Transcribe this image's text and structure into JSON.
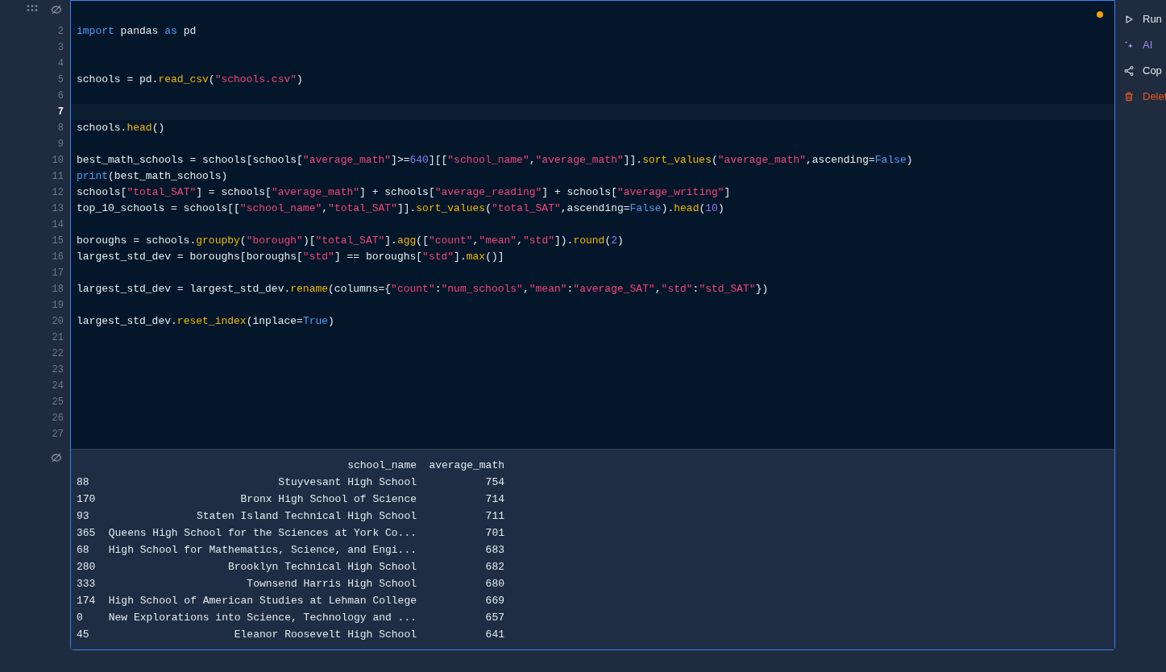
{
  "cell": {
    "modified": true,
    "lines": [
      {
        "number": "2",
        "current": false,
        "tokens": [
          {
            "kind": "keyword",
            "text": "import"
          },
          {
            "kind": "plain",
            "text": " pandas "
          },
          {
            "kind": "keyword",
            "text": "as"
          },
          {
            "kind": "plain",
            "text": " pd"
          }
        ]
      },
      {
        "number": "3",
        "current": false
      },
      {
        "number": "4",
        "current": false
      },
      {
        "number": "5",
        "current": false,
        "tokens": [
          {
            "kind": "plain",
            "text": "schools = pd."
          },
          {
            "kind": "function",
            "text": "read_csv"
          },
          {
            "kind": "plain",
            "text": "("
          },
          {
            "kind": "string",
            "text": "\"schools.csv\""
          },
          {
            "kind": "plain",
            "text": ")"
          }
        ]
      },
      {
        "number": "6",
        "current": false
      },
      {
        "number": "7",
        "current": true
      },
      {
        "number": "8",
        "current": false,
        "tokens": [
          {
            "kind": "plain",
            "text": "schools."
          },
          {
            "kind": "function",
            "text": "head"
          },
          {
            "kind": "plain",
            "text": "()"
          }
        ]
      },
      {
        "number": "9",
        "current": false
      },
      {
        "number": "10",
        "current": false,
        "tokens": [
          {
            "kind": "plain",
            "text": "best_math_schools = schools[schools["
          },
          {
            "kind": "string",
            "text": "\"average_math\""
          },
          {
            "kind": "plain",
            "text": "]>="
          },
          {
            "kind": "number",
            "text": "640"
          },
          {
            "kind": "plain",
            "text": "][["
          },
          {
            "kind": "string",
            "text": "\"school_name\""
          },
          {
            "kind": "plain",
            "text": ","
          },
          {
            "kind": "string",
            "text": "\"average_math\""
          },
          {
            "kind": "plain",
            "text": "]]."
          },
          {
            "kind": "function",
            "text": "sort_values"
          },
          {
            "kind": "plain",
            "text": "("
          },
          {
            "kind": "string",
            "text": "\"average_math\""
          },
          {
            "kind": "plain",
            "text": ",ascending="
          },
          {
            "kind": "keyword",
            "text": "False"
          },
          {
            "kind": "plain",
            "text": ")"
          }
        ]
      },
      {
        "number": "11",
        "current": false,
        "tokens": [
          {
            "kind": "keyword",
            "text": "print"
          },
          {
            "kind": "plain",
            "text": "(best_math_schools)"
          }
        ]
      },
      {
        "number": "12",
        "current": false,
        "tokens": [
          {
            "kind": "plain",
            "text": "schools["
          },
          {
            "kind": "string",
            "text": "\"total_SAT\""
          },
          {
            "kind": "plain",
            "text": "] = schools["
          },
          {
            "kind": "string",
            "text": "\"average_math\""
          },
          {
            "kind": "plain",
            "text": "] + schools["
          },
          {
            "kind": "string",
            "text": "\"average_reading\""
          },
          {
            "kind": "plain",
            "text": "] + schools["
          },
          {
            "kind": "string",
            "text": "\"average_writing\""
          },
          {
            "kind": "plain",
            "text": "]"
          }
        ]
      },
      {
        "number": "13",
        "current": false,
        "tokens": [
          {
            "kind": "plain",
            "text": "top_10_schools = schools[["
          },
          {
            "kind": "string",
            "text": "\"school_name\""
          },
          {
            "kind": "plain",
            "text": ","
          },
          {
            "kind": "string",
            "text": "\"total_SAT\""
          },
          {
            "kind": "plain",
            "text": "]]."
          },
          {
            "kind": "function",
            "text": "sort_values"
          },
          {
            "kind": "plain",
            "text": "("
          },
          {
            "kind": "string",
            "text": "\"total_SAT\""
          },
          {
            "kind": "plain",
            "text": ",ascending="
          },
          {
            "kind": "keyword",
            "text": "False"
          },
          {
            "kind": "plain",
            "text": ")."
          },
          {
            "kind": "function",
            "text": "head"
          },
          {
            "kind": "plain",
            "text": "("
          },
          {
            "kind": "number",
            "text": "10"
          },
          {
            "kind": "plain",
            "text": ")"
          }
        ]
      },
      {
        "number": "14",
        "current": false
      },
      {
        "number": "15",
        "current": false,
        "tokens": [
          {
            "kind": "plain",
            "text": "boroughs = schools."
          },
          {
            "kind": "function",
            "text": "groupby"
          },
          {
            "kind": "plain",
            "text": "("
          },
          {
            "kind": "string",
            "text": "\"borough\""
          },
          {
            "kind": "plain",
            "text": ")["
          },
          {
            "kind": "string",
            "text": "\"total_SAT\""
          },
          {
            "kind": "plain",
            "text": "]."
          },
          {
            "kind": "function",
            "text": "agg"
          },
          {
            "kind": "plain",
            "text": "(["
          },
          {
            "kind": "string",
            "text": "\"count\""
          },
          {
            "kind": "plain",
            "text": ","
          },
          {
            "kind": "string",
            "text": "\"mean\""
          },
          {
            "kind": "plain",
            "text": ","
          },
          {
            "kind": "string",
            "text": "\"std\""
          },
          {
            "kind": "plain",
            "text": "])."
          },
          {
            "kind": "function",
            "text": "round"
          },
          {
            "kind": "plain",
            "text": "("
          },
          {
            "kind": "number",
            "text": "2"
          },
          {
            "kind": "plain",
            "text": ")"
          }
        ]
      },
      {
        "number": "16",
        "current": false,
        "tokens": [
          {
            "kind": "plain",
            "text": "largest_std_dev = boroughs[boroughs["
          },
          {
            "kind": "string",
            "text": "\"std\""
          },
          {
            "kind": "plain",
            "text": "] == boroughs["
          },
          {
            "kind": "string",
            "text": "\"std\""
          },
          {
            "kind": "plain",
            "text": "]."
          },
          {
            "kind": "function",
            "text": "max"
          },
          {
            "kind": "plain",
            "text": "()]"
          }
        ]
      },
      {
        "number": "17",
        "current": false
      },
      {
        "number": "18",
        "current": false,
        "tokens": [
          {
            "kind": "plain",
            "text": "largest_std_dev = largest_std_dev."
          },
          {
            "kind": "function",
            "text": "rename"
          },
          {
            "kind": "plain",
            "text": "(columns={"
          },
          {
            "kind": "string",
            "text": "\"count\""
          },
          {
            "kind": "plain",
            "text": ":"
          },
          {
            "kind": "string",
            "text": "\"num_schools\""
          },
          {
            "kind": "plain",
            "text": ","
          },
          {
            "kind": "string",
            "text": "\"mean\""
          },
          {
            "kind": "plain",
            "text": ":"
          },
          {
            "kind": "string",
            "text": "\"average_SAT\""
          },
          {
            "kind": "plain",
            "text": ","
          },
          {
            "kind": "string",
            "text": "\"std\""
          },
          {
            "kind": "plain",
            "text": ":"
          },
          {
            "kind": "string",
            "text": "\"std_SAT\""
          },
          {
            "kind": "plain",
            "text": "})"
          }
        ]
      },
      {
        "number": "19",
        "current": false
      },
      {
        "number": "20",
        "current": false,
        "tokens": [
          {
            "kind": "plain",
            "text": "largest_std_dev."
          },
          {
            "kind": "function",
            "text": "reset_index"
          },
          {
            "kind": "plain",
            "text": "(inplace="
          },
          {
            "kind": "keyword",
            "text": "True"
          },
          {
            "kind": "plain",
            "text": ")"
          }
        ]
      },
      {
        "number": "21",
        "current": false
      },
      {
        "number": "22",
        "current": false
      },
      {
        "number": "23",
        "current": false
      },
      {
        "number": "24",
        "current": false
      },
      {
        "number": "25",
        "current": false
      },
      {
        "number": "26",
        "current": false
      },
      {
        "number": "27",
        "current": false
      }
    ],
    "output": {
      "columns": [
        "school_name",
        "average_math"
      ],
      "rows": [
        {
          "index": "88",
          "school_name": "Stuyvesant High School",
          "average_math": "754"
        },
        {
          "index": "170",
          "school_name": "Bronx High School of Science",
          "average_math": "714"
        },
        {
          "index": "93",
          "school_name": "Staten Island Technical High School",
          "average_math": "711"
        },
        {
          "index": "365",
          "school_name": "Queens High School for the Sciences at York Co...",
          "average_math": "701"
        },
        {
          "index": "68",
          "school_name": "High School for Mathematics, Science, and Engi...",
          "average_math": "683"
        },
        {
          "index": "280",
          "school_name": "Brooklyn Technical High School",
          "average_math": "682"
        },
        {
          "index": "333",
          "school_name": "Townsend Harris High School",
          "average_math": "680"
        },
        {
          "index": "174",
          "school_name": "High School of American Studies at Lehman College",
          "average_math": "669"
        },
        {
          "index": "0",
          "school_name": "New Explorations into Science, Technology and ...",
          "average_math": "657"
        },
        {
          "index": "45",
          "school_name": "Eleanor Roosevelt High School",
          "average_math": "641"
        }
      ]
    }
  },
  "actions": [
    {
      "kind": "run",
      "label": "Run"
    },
    {
      "kind": "ai",
      "label": "AI"
    },
    {
      "kind": "copy",
      "label": "Cop"
    },
    {
      "kind": "delete",
      "label": "Delet"
    }
  ]
}
